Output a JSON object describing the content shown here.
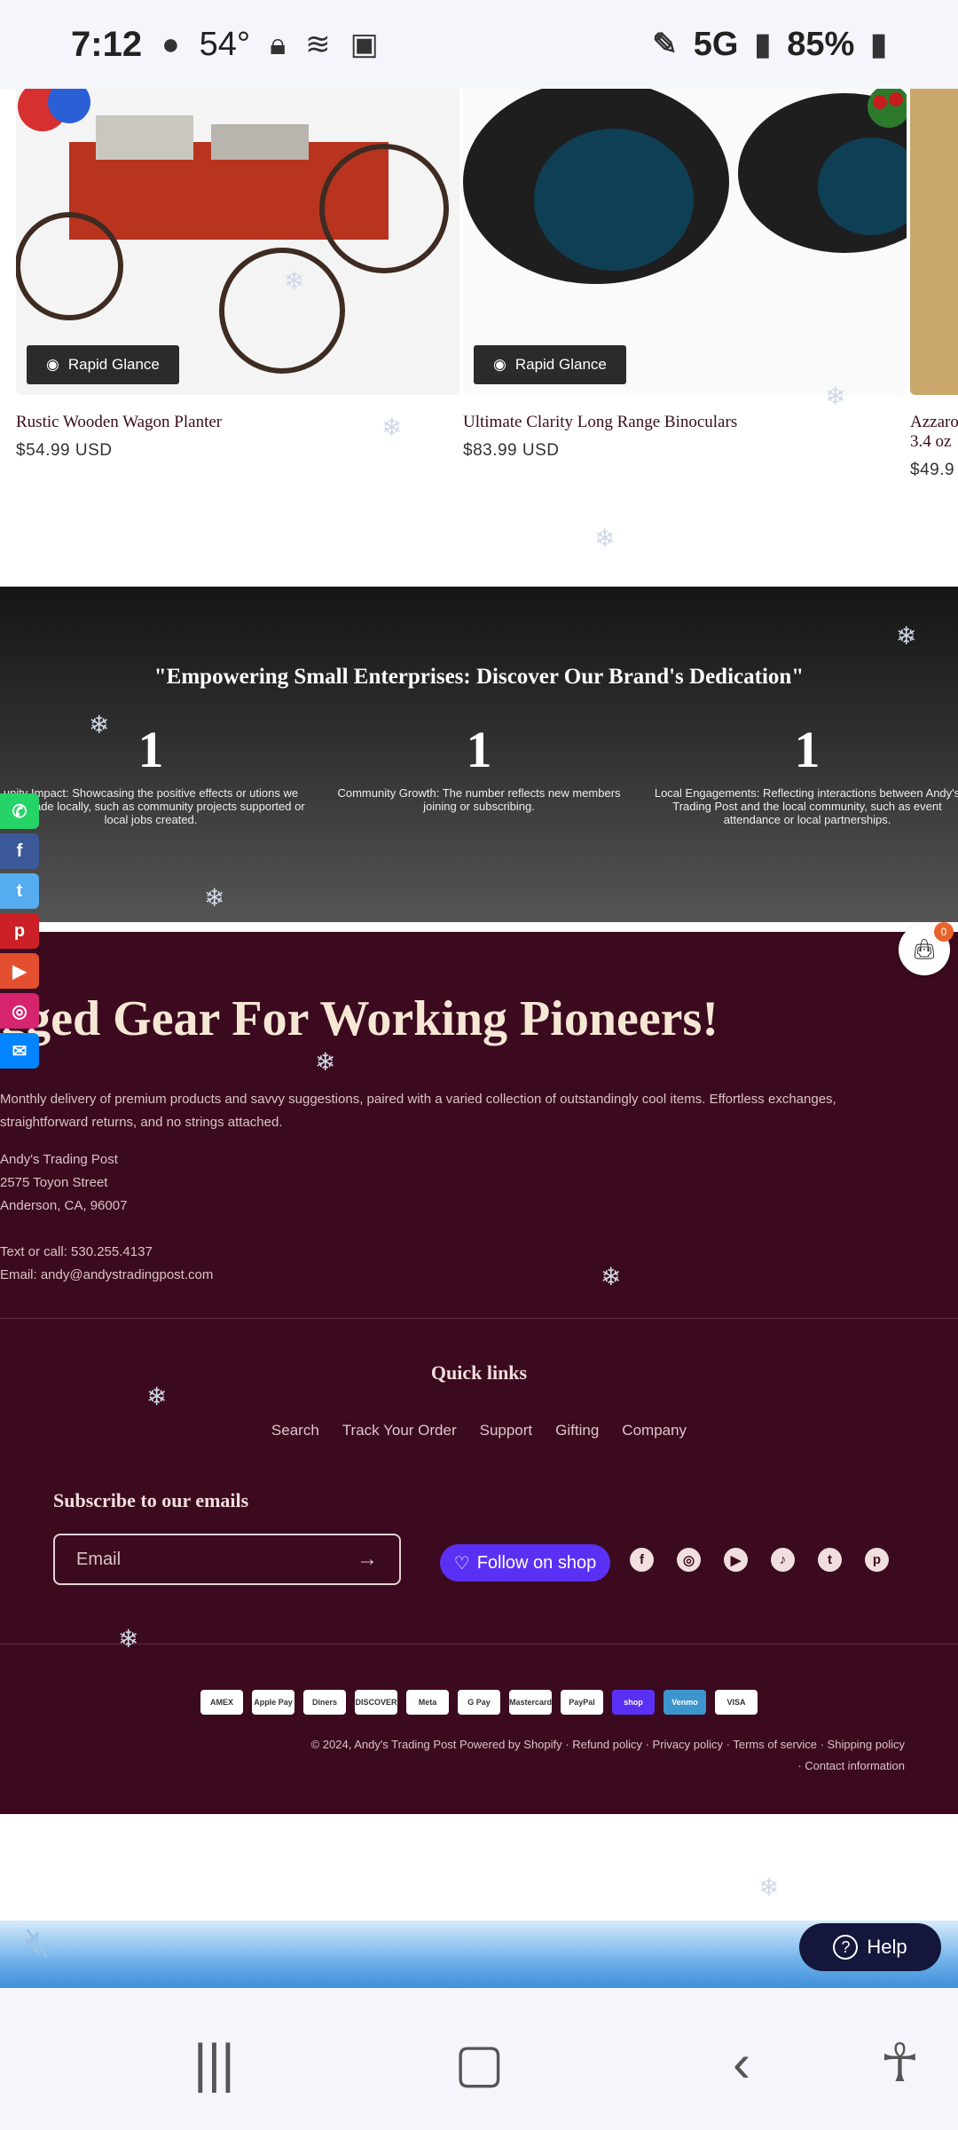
{
  "status_bar": {
    "time": "7:12",
    "temp": "54°",
    "network": "5G",
    "battery": "85%"
  },
  "products": [
    {
      "name": "Rustic Wooden Wagon Planter",
      "price": "$54.99 USD",
      "quick_view": "Rapid Glance"
    },
    {
      "name": "Ultimate Clarity Long Range Binoculars",
      "price": "$83.99 USD",
      "quick_view": "Rapid Glance"
    },
    {
      "name": "Azzaro 3.4 oz",
      "price": "$49.9"
    }
  ],
  "dedication": {
    "title": "\"Empowering Small Enterprises: Discover Our Brand's Dedication\"",
    "stats": [
      {
        "value": "1",
        "text": "unity Impact: Showcasing the positive effects or utions we have made locally, such as community projects supported or local jobs created."
      },
      {
        "value": "1",
        "text": "Community Growth: The number reflects new members joining or subscribing."
      },
      {
        "value": "1",
        "text": "Local Engagements: Reflecting interactions between Andy's Trading Post and the local community, such as event attendance or local partnerships."
      }
    ]
  },
  "footer": {
    "headline": "ugged Gear For Working Pioneers!",
    "description": "Monthly delivery of premium products and savvy suggestions, paired with a varied collection of outstandingly cool items. Effortless exchanges, straightforward returns, and no strings attached.",
    "address": [
      "Andy's Trading Post",
      "2575 Toyon Street",
      "Anderson, CA, 96007"
    ],
    "phone": "Text or call: 530.255.4137",
    "email": "Email: andy@andystradingpost.com",
    "quick_links_title": "Quick links",
    "quick_links": [
      "Search",
      "Track Your Order",
      "Support",
      "Gifting",
      "Company"
    ],
    "subscribe_title": "Subscribe to our emails",
    "email_placeholder": "Email",
    "follow_label": "Follow on shop",
    "social_icons": [
      "facebook-icon",
      "instagram-icon",
      "youtube-icon",
      "tiktok-icon",
      "twitter-icon",
      "pinterest-icon"
    ],
    "payment_methods": [
      "AMEX",
      "Apple Pay",
      "Diners",
      "DISCOVER",
      "Meta",
      "G Pay",
      "Mastercard",
      "PayPal",
      "shop",
      "Venmo",
      "VISA"
    ],
    "copyright": "© 2024, Andy's Trading Post Powered by Shopify",
    "policies": [
      "Refund policy",
      "Privacy policy",
      "Terms of service",
      "Shipping policy",
      "Contact information"
    ]
  },
  "cart_count": "0",
  "help_label": "Help",
  "colors": {
    "footer_bg": "#3c0a1e",
    "shop_purple": "#5a31f4",
    "help_bg": "#14163b"
  }
}
